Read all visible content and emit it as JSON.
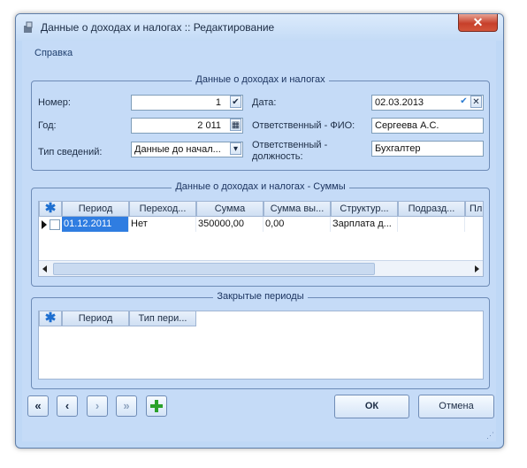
{
  "window": {
    "title": "Данные о доходах и налогах :: Редактирование",
    "close": "✕"
  },
  "menu": {
    "help": "Справка"
  },
  "info": {
    "group_title": "Данные о доходах и налогах",
    "number_label": "Номер:",
    "number_value": "1",
    "year_label": "Год:",
    "year_value": "2 011",
    "type_label": "Тип сведений:",
    "type_value": "Данные до начал...",
    "date_label": "Дата:",
    "date_value": "02.03.2013",
    "resp_fio_label": "Ответственный - ФИО:",
    "resp_fio_value": "Сергеева А.С.",
    "resp_pos_label": "Ответственный - должность:",
    "resp_pos_value": "Бухгалтер"
  },
  "sums": {
    "group_title": "Данные о доходах и налогах - Суммы",
    "columns": [
      "Период",
      "Переход...",
      "Сумма",
      "Сумма вы...",
      "Структур...",
      "Подразд...",
      "Пл"
    ],
    "row": {
      "period": "01.12.2011",
      "transition": "Нет",
      "sum": "350000,00",
      "sum_out": "0,00",
      "structure": "Зарплата д..."
    }
  },
  "closed": {
    "group_title": "Закрытые периоды",
    "columns": [
      "Период",
      "Тип пери..."
    ]
  },
  "buttons": {
    "first": "«",
    "prev": "‹",
    "next": "›",
    "last": "»",
    "ok": "ОК",
    "cancel": "Отмена"
  },
  "colors": {
    "accent": "#1e6fd0",
    "selection": "#2f7de1",
    "add_green": "#2aa12a"
  }
}
